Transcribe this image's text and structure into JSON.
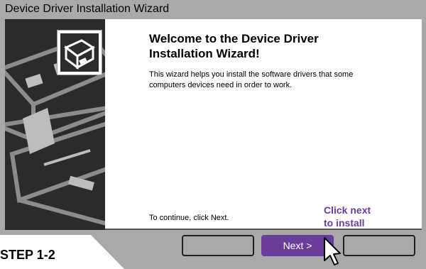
{
  "window": {
    "title": "Device Driver Installation Wizard"
  },
  "wizard": {
    "heading": "Welcome to the Device Driver Installation Wizard!",
    "intro": "This wizard helps you install the software drivers that some computers devices need in order to work.",
    "continue_text": "To continue, click Next."
  },
  "buttons": {
    "back_label": "",
    "next_label": "Next >",
    "cancel_label": ""
  },
  "annotation": {
    "callout": "Click next\nto install",
    "step": "STEP 1-2"
  },
  "icons": {
    "wizard": "driver-box-icon",
    "cursor": "mouse-pointer-icon"
  },
  "colors": {
    "accent": "#6a3d9a",
    "window": "#a9a9a9",
    "side_panel": "#2b2b2b"
  }
}
